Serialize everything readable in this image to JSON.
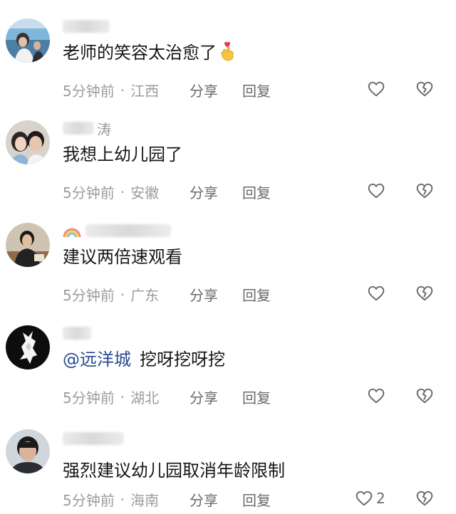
{
  "comments": [
    {
      "username_tail": "",
      "text": "老师的笑容太治愈了",
      "mention": "",
      "time": "5分钟前",
      "location": "江西",
      "share_label": "分享",
      "reply_label": "回复",
      "like_count": "",
      "emoji": "hand-heart-emoji-icon",
      "avatar": "person-by-sea-avatar"
    },
    {
      "username_tail": "涛",
      "text": "我想上幼儿园了",
      "mention": "",
      "time": "5分钟前",
      "location": "安徽",
      "share_label": "分享",
      "reply_label": "回复",
      "like_count": "",
      "avatar": "two-people-selfie-avatar"
    },
    {
      "username_tail": "",
      "text": "建议两倍速观看",
      "mention": "",
      "time": "5分钟前",
      "location": "广东",
      "share_label": "分享",
      "reply_label": "回复",
      "like_count": "",
      "username_icon": "rainbow-icon",
      "avatar": "person-at-desk-avatar"
    },
    {
      "username_tail": "",
      "text": "挖呀挖呀挖",
      "mention": "@远洋城",
      "time": "5分钟前",
      "location": "湖北",
      "share_label": "分享",
      "reply_label": "回复",
      "like_count": "",
      "avatar": "white-bird-black-avatar"
    },
    {
      "username_tail": "",
      "text": "强烈建议幼儿园取消年龄限制",
      "mention": "",
      "time": "5分钟前",
      "location": "海南",
      "share_label": "分享",
      "reply_label": "回复",
      "like_count": "2",
      "avatar": "man-portrait-avatar"
    }
  ],
  "colors": {
    "text": "#161616",
    "meta": "#9c9c9c",
    "action": "#6a6a6a",
    "mention": "#2a4a8f"
  }
}
